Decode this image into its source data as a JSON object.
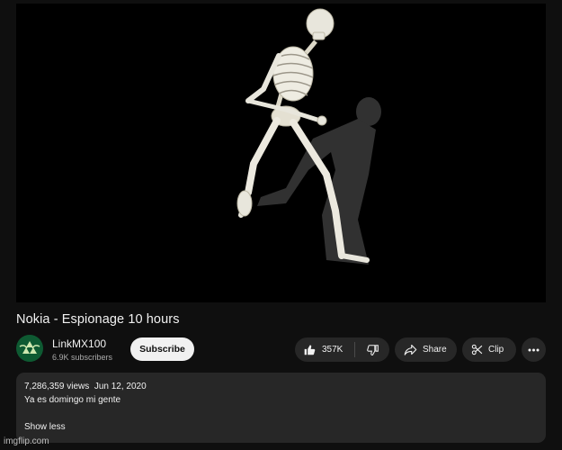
{
  "video": {
    "title": "Nokia - Espionage 10 hours"
  },
  "channel": {
    "name": "LinkMX100",
    "subscribers": "6.9K subscribers",
    "subscribe_label": "Subscribe"
  },
  "actions": {
    "like_count": "357K",
    "share_label": "Share",
    "clip_label": "Clip"
  },
  "description": {
    "views": "7,286,359 views",
    "date": "Jun 12, 2020",
    "text": "Ya es domingo mi gente",
    "show_less": "Show less"
  },
  "watermark": "imgflip.com",
  "colors": {
    "background": "#0f0f0f",
    "surface": "#272727",
    "text": "#f1f1f1",
    "secondary_text": "#aaaaaa",
    "subscribe_bg": "#f1f1f1"
  }
}
